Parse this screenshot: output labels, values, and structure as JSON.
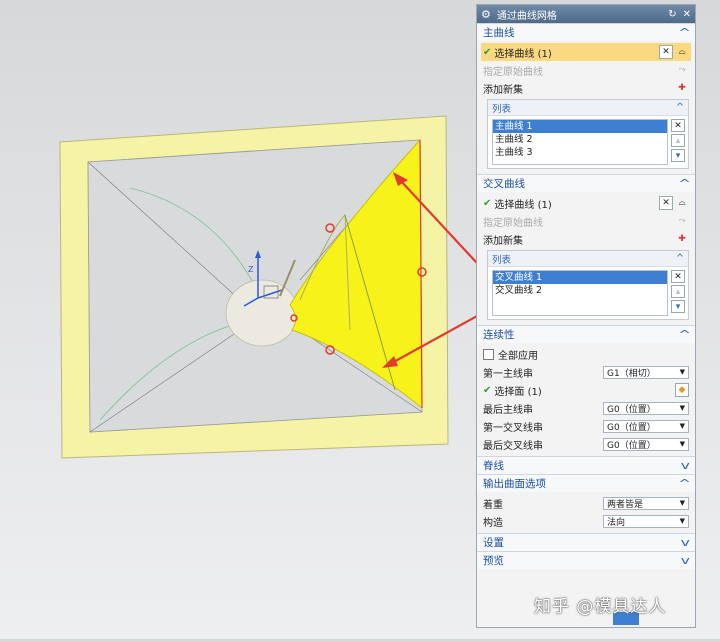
{
  "dialog": {
    "title": "通过曲线网格",
    "primary": {
      "header": "主曲线",
      "select_label": "选择曲线 (1)",
      "specify_origin": "指定原始曲线",
      "add_set": "添加新集",
      "list_header": "列表",
      "items": [
        "主曲线 1",
        "主曲线 2",
        "主曲线 3"
      ]
    },
    "cross": {
      "header": "交叉曲线",
      "select_label": "选择曲线 (1)",
      "specify_origin": "指定原始曲线",
      "add_set": "添加新集",
      "list_header": "列表",
      "items": [
        "交叉曲线 1",
        "交叉曲线 2"
      ]
    },
    "continuity": {
      "header": "连续性",
      "apply_all": "全部应用",
      "first_primary": {
        "label": "第一主线串",
        "value": "G1（相切）"
      },
      "select_face": "选择面 (1)",
      "last_primary": {
        "label": "最后主线串",
        "value": "G0（位置）"
      },
      "first_cross": {
        "label": "第一交叉线串",
        "value": "G0（位置）"
      },
      "last_cross": {
        "label": "最后交叉线串",
        "value": "G0（位置）"
      }
    },
    "spine": {
      "header": "脊线"
    },
    "output": {
      "header": "输出曲面选项",
      "emphasis": {
        "label": "着重",
        "value": "两者皆是"
      },
      "construction": {
        "label": "构造",
        "value": "法向"
      }
    },
    "settings": {
      "header": "设置"
    },
    "preview": {
      "header": "预览"
    }
  },
  "watermark": "知乎 @模具达人",
  "colors": {
    "accent": "#1a4f9c",
    "selection": "#3e7fd2",
    "highlight": "#fbd981",
    "surface": "#f7f21a",
    "arrow": "#e23a2e"
  }
}
